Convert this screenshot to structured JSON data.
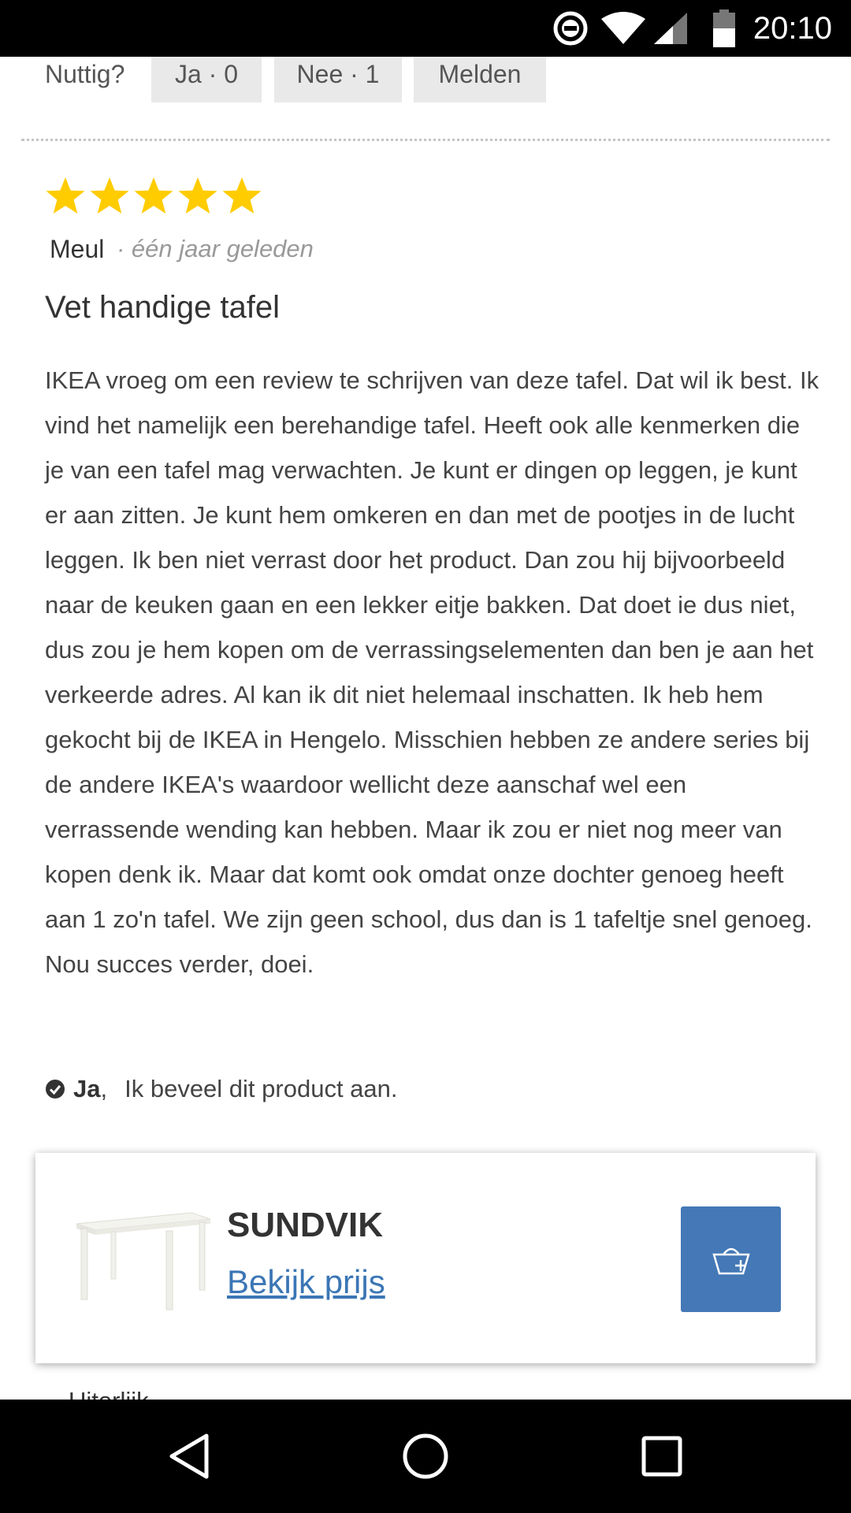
{
  "status_bar": {
    "time": "20:10",
    "icons": [
      "do-not-disturb-icon",
      "wifi-icon",
      "cell-signal-icon",
      "battery-icon"
    ]
  },
  "helpful": {
    "label": "Nuttig?",
    "yes_label": "Ja · 0",
    "no_label": "Nee · 1",
    "report_label": "Melden"
  },
  "review": {
    "rating": 5,
    "rating_max": 5,
    "star_color": "#ffcc00",
    "reviewer": "Meul",
    "date": "· één jaar geleden",
    "title": "Vet handige tafel",
    "body": "IKEA vroeg om een review te schrijven van deze tafel. Dat wil ik best. Ik vind het namelijk een berehandige tafel. Heeft ook alle kenmerken die je van een tafel mag verwachten. Je kunt er dingen op leggen, je kunt er aan zitten. Je kunt hem omkeren en dan met de pootjes in de lucht leggen. Ik ben niet verrast door het product. Dan zou hij bijvoorbeeld naar de keuken gaan en een lekker eitje bakken. Dat doet ie dus niet, dus zou je hem kopen om de verrassingselementen dan ben je aan het verkeerde adres. Al kan ik dit niet helemaal inschatten. Ik heb hem gekocht bij de IKEA in Hengelo. Misschien hebben ze andere series bij de andere IKEA's waardoor wellicht deze aanschaf wel een verrassende wending kan hebben. Maar ik zou er niet nog meer van kopen denk ik. Maar dat komt ook omdat onze dochter genoeg heeft aan 1 zo'n tafel. We zijn geen school, dus dan is 1 tafeltje snel genoeg. Nou succes verder, doei.",
    "recommend_yes": "Ja",
    "recommend_comma": ",",
    "recommend_text": "Ik beveel dit product aan."
  },
  "product": {
    "name": "SUNDVIK",
    "price_link": "Bekijk prijs",
    "cart_icon": "add-to-cart-icon",
    "button_color": "#4478b6",
    "link_color": "#3b76b5"
  },
  "next_section_label": "Uiterlijk",
  "nav_bar": {
    "buttons": [
      "back-icon",
      "home-icon",
      "recents-icon"
    ]
  }
}
